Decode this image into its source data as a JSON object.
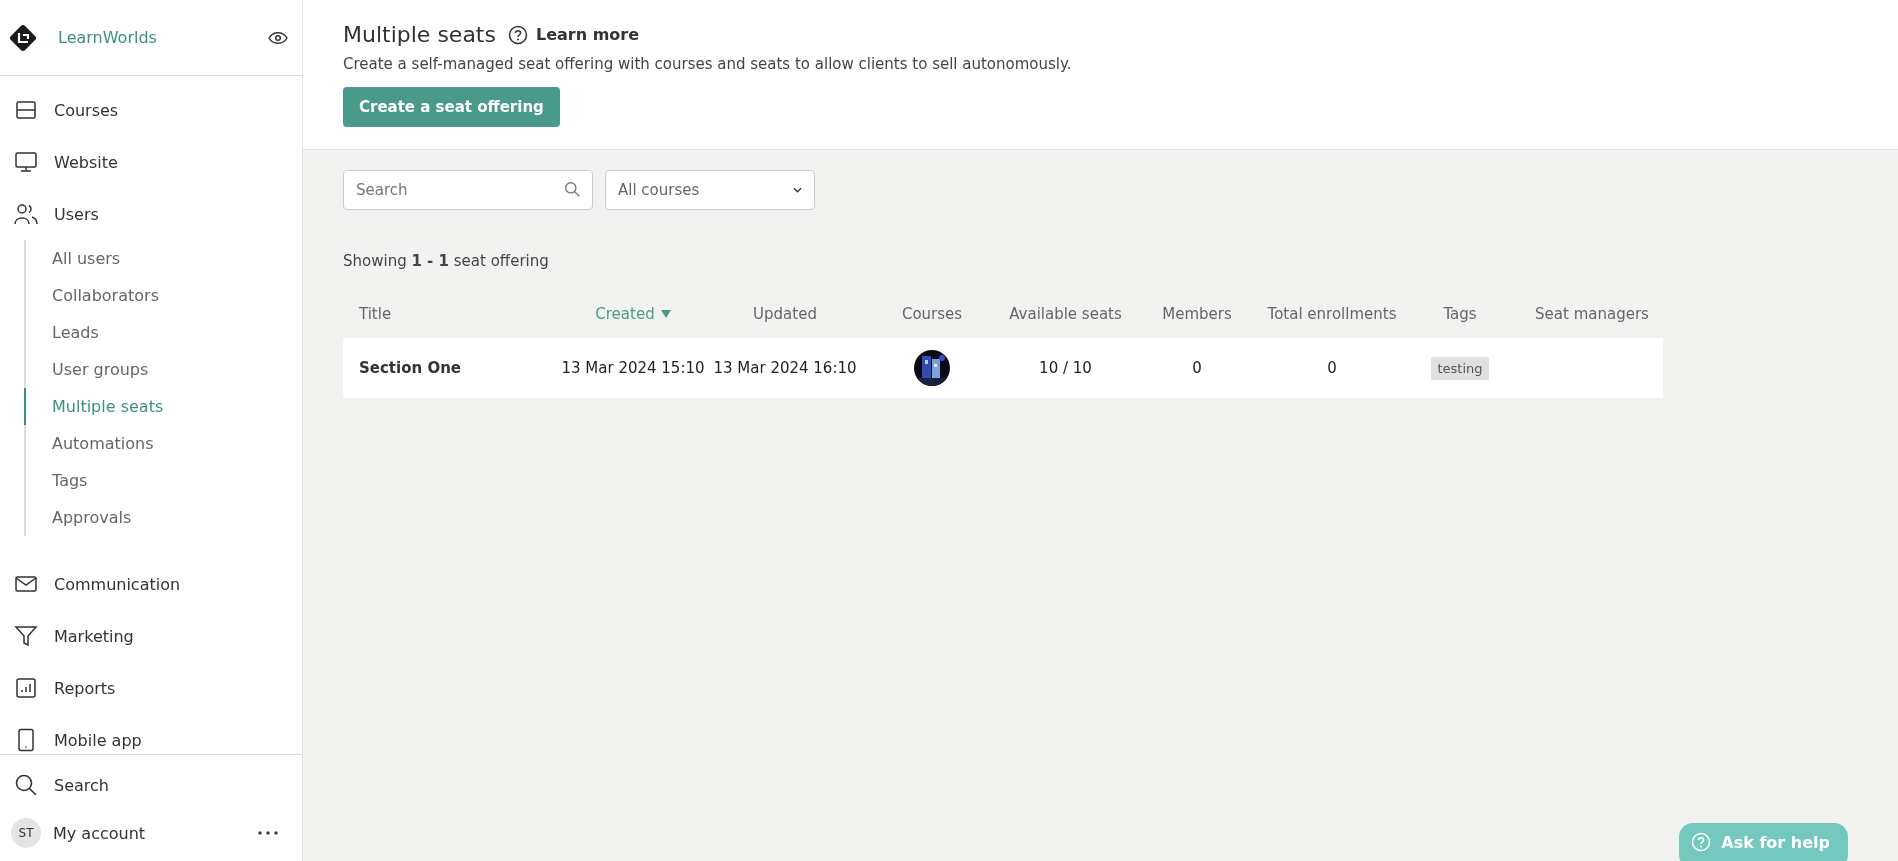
{
  "brand": {
    "name": "LearnWorlds"
  },
  "sidebar": {
    "items": [
      {
        "label": "Courses"
      },
      {
        "label": "Website"
      },
      {
        "label": "Users",
        "children": [
          {
            "label": "All users",
            "selected": false
          },
          {
            "label": "Collaborators",
            "selected": false
          },
          {
            "label": "Leads",
            "selected": false
          },
          {
            "label": "User groups",
            "selected": false
          },
          {
            "label": "Multiple seats",
            "selected": true
          },
          {
            "label": "Automations",
            "selected": false
          },
          {
            "label": "Tags",
            "selected": false
          },
          {
            "label": "Approvals",
            "selected": false
          }
        ]
      },
      {
        "label": "Communication"
      },
      {
        "label": "Marketing"
      },
      {
        "label": "Reports"
      },
      {
        "label": "Mobile app"
      }
    ],
    "footer": {
      "search": "Search",
      "avatar": "ST",
      "account": "My account"
    }
  },
  "header": {
    "title": "Multiple seats",
    "learn_more": "Learn more",
    "description": "Create a self-managed seat offering with courses and seats to allow clients to sell autonomously.",
    "button": "Create a seat offering"
  },
  "filters": {
    "search": {
      "placeholder": "Search"
    },
    "course_select": {
      "value": "All courses"
    }
  },
  "summary": "Showing **1 - 1** seat offering",
  "table": {
    "columns": [
      {
        "label": "Title",
        "sorted": false
      },
      {
        "label": "Created",
        "sorted": true
      },
      {
        "label": "Updated",
        "sorted": false
      },
      {
        "label": "Courses",
        "sorted": false
      },
      {
        "label": "Available seats",
        "sorted": false
      },
      {
        "label": "Members",
        "sorted": false
      },
      {
        "label": "Total enrollments",
        "sorted": false
      },
      {
        "label": "Tags",
        "sorted": false
      },
      {
        "label": "Seat managers",
        "sorted": false
      }
    ],
    "rows": [
      {
        "title": "Section One",
        "created": "13 Mar 2024 15:10",
        "updated": "13 Mar 2024 16:10",
        "available_seats": "10 / 10",
        "members": "0",
        "total_enrollments": "0",
        "tags": [
          "testing"
        ]
      }
    ]
  },
  "help_button": "Ask for help"
}
